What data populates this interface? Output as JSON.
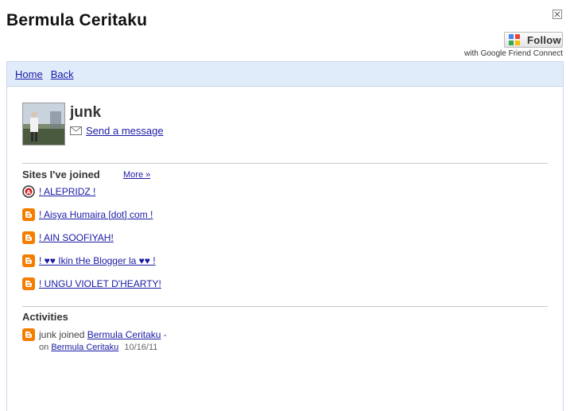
{
  "header": {
    "title": "Bermula Ceritaku",
    "follow_label": "Follow",
    "gfc_caption": "with Google Friend Connect"
  },
  "nav": {
    "home": "Home",
    "back": "Back"
  },
  "profile": {
    "name": "junk",
    "send_message": "Send a message"
  },
  "sites": {
    "title": "Sites I've joined",
    "more": "More »",
    "items": [
      {
        "label": "! ALEPRIDZ !",
        "icon": "site-badge-icon"
      },
      {
        "label": "! Aisya Humaira [dot] com !",
        "icon": "blogger-icon"
      },
      {
        "label": "! AIN SOOFIYAH!",
        "icon": "blogger-icon"
      },
      {
        "label": "! ♥♥ Ikin tHe Blogger la ♥♥ !",
        "icon": "blogger-icon"
      },
      {
        "label": "! UNGU VIOLET D'HEARTY!",
        "icon": "blogger-icon"
      }
    ]
  },
  "activities": {
    "title": "Activities",
    "actor": "junk",
    "verb": "joined",
    "target": "Bermula Ceritaku",
    "dash": "-",
    "on_prefix": "on",
    "on_site": "Bermula Ceritaku",
    "date": "10/16/11"
  },
  "colors": {
    "blogger_orange": "#f57d00",
    "nav_bg": "#e1ecfb",
    "link": "#1a1aa6"
  }
}
